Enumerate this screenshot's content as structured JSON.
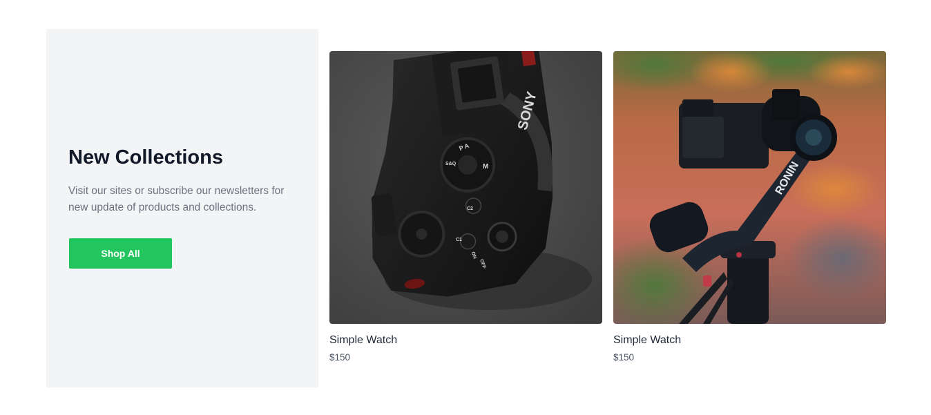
{
  "promo": {
    "title": "New Collections",
    "description": "Visit our sites or subscribe our newsletters for new update of products and collections.",
    "button_label": "Shop All",
    "button_color": "#22c55e",
    "background_color": "#f3f4f6"
  },
  "products": [
    {
      "name": "Simple Watch",
      "price": "$150",
      "image_subject": "camera-top-view-image",
      "image_text": {
        "brand": "SONY",
        "mode_top": "P A",
        "mode_m": "M",
        "dial_label": "S&Q",
        "c2": "C2",
        "c1": "C1",
        "on": "ON",
        "off": "OFF"
      }
    },
    {
      "name": "Simple Watch",
      "price": "$150",
      "image_subject": "camera-gimbal-image",
      "image_text": {
        "brand": "RONIN"
      }
    }
  ]
}
